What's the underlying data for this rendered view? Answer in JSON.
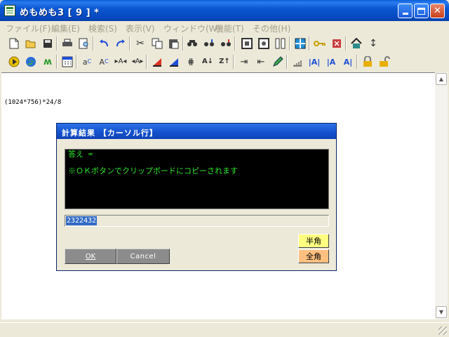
{
  "window": {
    "title": "めもめも3 [ 9 ] *"
  },
  "menu": {
    "items": [
      {
        "label": "ファイル(F)"
      },
      {
        "label": "編集(E)"
      },
      {
        "label": "検索(S)"
      },
      {
        "label": "表示(V)"
      },
      {
        "label": "ウィンドウ(W)"
      },
      {
        "label": "機能(T)"
      },
      {
        "label": "その他(H)"
      }
    ]
  },
  "toolbar": {
    "row1_icons": [
      "new-file-icon",
      "open-folder-icon",
      "save-icon",
      "print-icon",
      "print-preview-icon",
      "undo-icon",
      "redo-icon",
      "cut-icon",
      "copy-icon",
      "paste-icon",
      "find-icon",
      "find-next-icon",
      "find-prev-icon",
      "record-stop-icon",
      "record-icon",
      "columns-icon",
      "grid-window-icon",
      "key-icon",
      "close-window-icon",
      "home-icon",
      "updown-arrow-icon"
    ],
    "row2_icons": [
      "play-icon",
      "globe-icon",
      "marker-icon",
      "calculator-icon",
      "text-a-icon",
      "text-ac-icon",
      "text-ca-icon",
      "text-xa-icon",
      "triangle-icon",
      "triangle-blue-icon",
      "hash-icon",
      "sort-az-icon",
      "sort-za-icon",
      "indent-right-icon",
      "indent-left-icon",
      "pencil-icon",
      "ruler-icon",
      "align-ia-icon",
      "align-ia2-icon",
      "align-aa-icon",
      "lock-icon",
      "unlock-icon"
    ]
  },
  "editor": {
    "line_text": "(1024*756)*24/8"
  },
  "dialog": {
    "title": "計算結果 【カーソル行】",
    "output_line1": "答え  =",
    "output_line2": "※ＯＫボタンでクリップボードにコピーされます",
    "result_value": "2322432",
    "half_width_label": "半角",
    "full_width_label": "全角",
    "ok_label": "OK",
    "cancel_label": "Cancel"
  },
  "colors": {
    "titlebar": "#0A57D2",
    "output_bg": "#000000",
    "output_text": "#2EE62E",
    "selection": "#316AC5",
    "half_width_bg": "#FFFF80",
    "full_width_bg": "#FFC080"
  }
}
